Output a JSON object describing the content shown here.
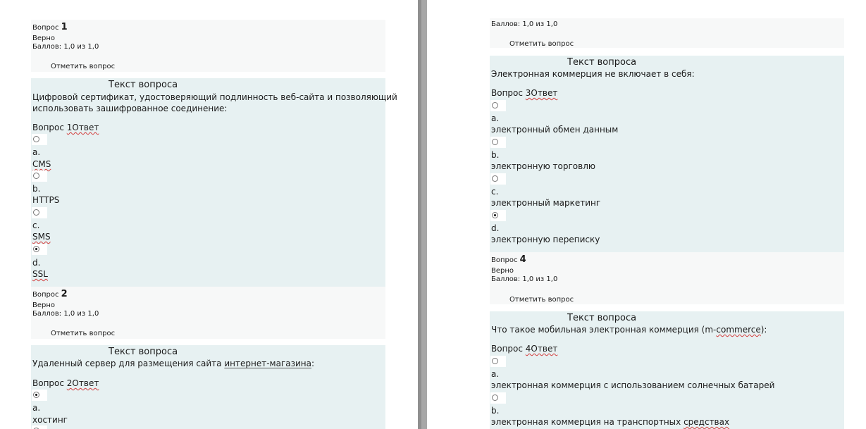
{
  "left": {
    "q1": {
      "label": "Вопрос",
      "number": "1",
      "status": "Верно",
      "score": "Баллов: 1,0 из 1,0",
      "flag": "Отметить вопрос",
      "heading": "Текст вопроса",
      "text_line1": "Цифровой сертификат, удостоверяющий подлинность веб-сайта и позволяющий",
      "text_line2": "использовать зашифрованное соединение:",
      "answer_prefix": "Вопрос ",
      "answer_word": "1Ответ",
      "options": [
        {
          "letter": "a.",
          "text": "CMS",
          "checked": false
        },
        {
          "letter": "b.",
          "text": "HTTPS",
          "checked": false
        },
        {
          "letter": "c.",
          "text": "SMS",
          "checked": false
        },
        {
          "letter": "d.",
          "text": "SSL",
          "checked": true
        }
      ]
    },
    "q2": {
      "label": "Вопрос",
      "number": "2",
      "status": "Верно",
      "score": "Баллов: 1,0 из 1,0",
      "flag": "Отметить вопрос",
      "heading": "Текст вопроса",
      "text_before": "Удаленный сервер для размещения сайта ",
      "text_link": "интернет-магазина",
      "text_after": ":",
      "answer_prefix": "Вопрос ",
      "answer_word": "2Ответ",
      "options": [
        {
          "letter": "a.",
          "text": "хостинг",
          "checked": true
        }
      ]
    }
  },
  "right": {
    "q3": {
      "score": "Баллов: 1,0 из 1,0",
      "flag": "Отметить вопрос",
      "heading": "Текст вопроса",
      "text": "Электронная коммерция не включает в себя:",
      "answer_prefix": "Вопрос ",
      "answer_word": "3Ответ",
      "options": [
        {
          "letter": "a.",
          "text": "электронный обмен данным",
          "checked": false
        },
        {
          "letter": "b.",
          "text": "электронную торговлю",
          "checked": false
        },
        {
          "letter": "c.",
          "text": "электронный маркетинг",
          "checked": false
        },
        {
          "letter": "d.",
          "text": "электронную переписку",
          "checked": true
        }
      ]
    },
    "q4": {
      "label": "Вопрос",
      "number": "4",
      "status": "Верно",
      "score": "Баллов: 1,0 из 1,0",
      "flag": "Отметить вопрос",
      "heading": "Текст вопроса",
      "text_before": "Что такое мобильная электронная коммерция (m-",
      "text_link": "commerce",
      "text_after": "):",
      "answer_prefix": "Вопрос ",
      "answer_word": "4Ответ",
      "options": [
        {
          "letter": "a.",
          "text": "электронная коммерция с использованием солнечных батарей",
          "checked": false
        },
        {
          "letter": "b.",
          "text_before": "электронная коммерция на транспортных ",
          "text_link": "средствах",
          "checked": false
        }
      ]
    }
  }
}
